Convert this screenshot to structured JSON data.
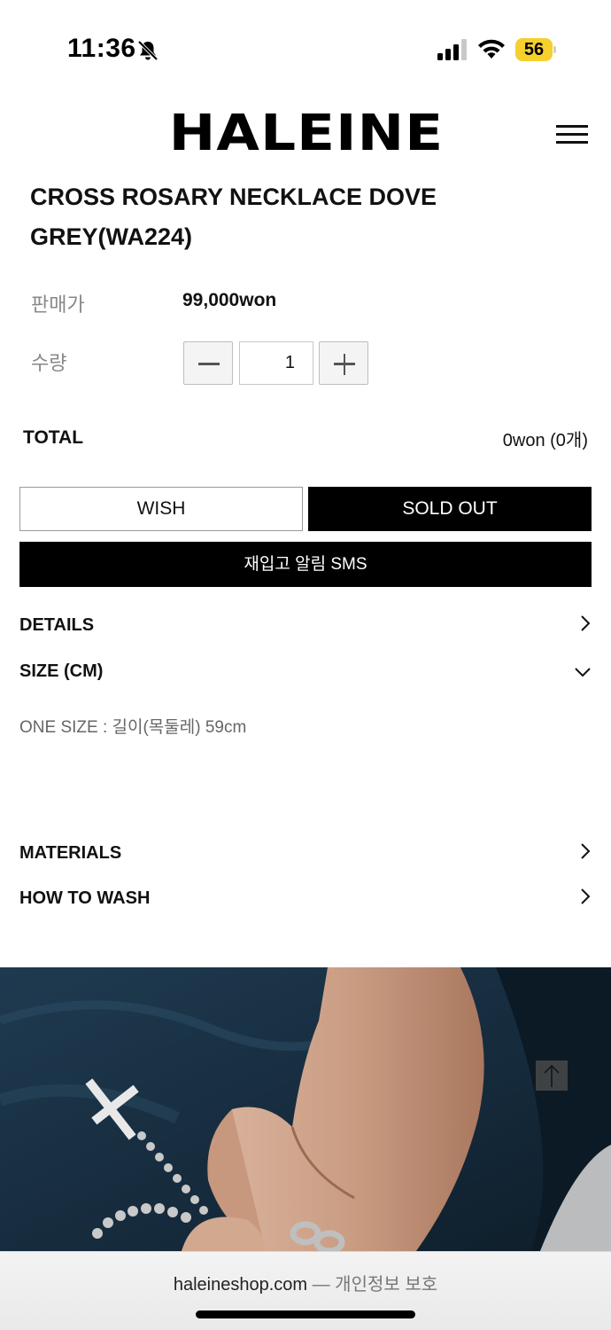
{
  "status_bar": {
    "time": "11:36",
    "battery": "56",
    "icons": [
      "bell-slash-icon",
      "signal-icon",
      "wifi-icon",
      "battery-icon"
    ],
    "battery_color": "#f5d02e"
  },
  "header": {
    "logo": "HALEINE",
    "menu_icon": "hamburger-menu-icon"
  },
  "product": {
    "title_line1": "CROSS ROSARY NECKLACE DOVE",
    "title_line2": "GREY(WA224)",
    "price_label": "판매가",
    "price": "99,000won",
    "quantity_label": "수량",
    "quantity": "1",
    "minus_icon": "minus-icon",
    "plus_icon": "plus-icon"
  },
  "total": {
    "label": "TOTAL",
    "value": "0won (0개)"
  },
  "actions": {
    "wish": "WISH",
    "sold_out": "SOLD OUT",
    "sms": "재입고 알림 SMS"
  },
  "accordion": {
    "details": "DETAILS",
    "size": "SIZE (CM)",
    "size_content": "ONE SIZE : 길이(목둘레) 59cm",
    "materials": "MATERIALS",
    "how_to_wash": "HOW TO WASH"
  },
  "scroll_top_icon": "arrow-up-icon",
  "browser": {
    "domain": "haleineshop.com",
    "suffix": "— 개인정보 보호"
  },
  "colors": {
    "primary": "#000000",
    "background": "#ffffff",
    "muted_text": "#888888"
  }
}
